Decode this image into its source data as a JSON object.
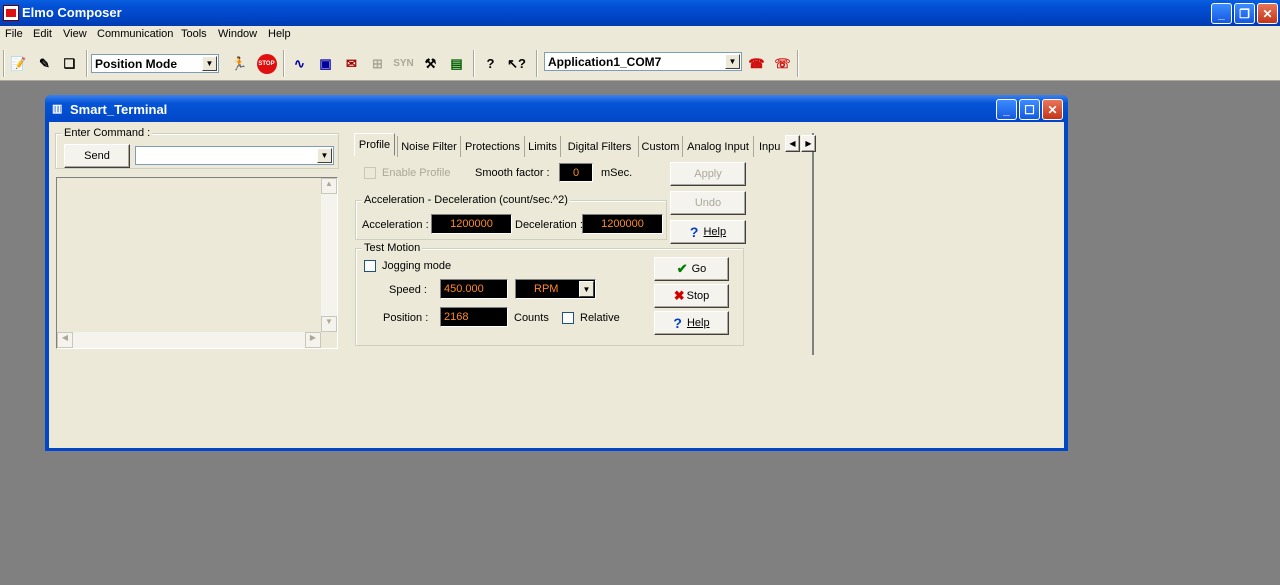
{
  "app": {
    "title": "Elmo Composer"
  },
  "menu": [
    "File",
    "Edit",
    "View",
    "Communication",
    "Tools",
    "Window",
    "Help"
  ],
  "toolbar": {
    "mode_value": "Position Mode",
    "connection_value": "Application1_COM7",
    "stop_label": "STOP",
    "syn_label": "SYN"
  },
  "child": {
    "title": "Smart_Terminal",
    "command_group_label": "Enter Command :",
    "send_label": "Send",
    "command_value": ""
  },
  "tabs": [
    "Profile",
    "Noise Filter",
    "Protections",
    "Limits",
    "Digital Filters",
    "Custom",
    "Analog Input",
    "Inpu"
  ],
  "profile": {
    "enable_profile_label": "Enable Profile",
    "smooth_factor_label": "Smooth factor :",
    "smooth_factor_value": "0",
    "smooth_unit": "mSec.",
    "apply_label": "Apply",
    "undo_label": "Undo",
    "help_label": "Help",
    "accel_group_label": "Acceleration - Deceleration (count/sec.^2)",
    "acceleration_label": "Acceleration :",
    "acceleration_value": "1200000",
    "deceleration_label": "Deceleration :",
    "deceleration_value": "1200000"
  },
  "test_motion": {
    "group_label": "Test Motion",
    "jogging_label": "Jogging mode",
    "speed_label": "Speed :",
    "speed_value": "450.000",
    "speed_unit": "RPM",
    "position_label": "Position :",
    "position_value": "2168",
    "counts_label": "Counts",
    "relative_label": "Relative",
    "go_label": "Go",
    "stop_label": "Stop",
    "help_label": "Help"
  },
  "colors": {
    "titlebar_blue": "#0046c8",
    "panel": "#ece9d8",
    "lcd_text": "#ff8a24",
    "desktop": "#808080"
  }
}
